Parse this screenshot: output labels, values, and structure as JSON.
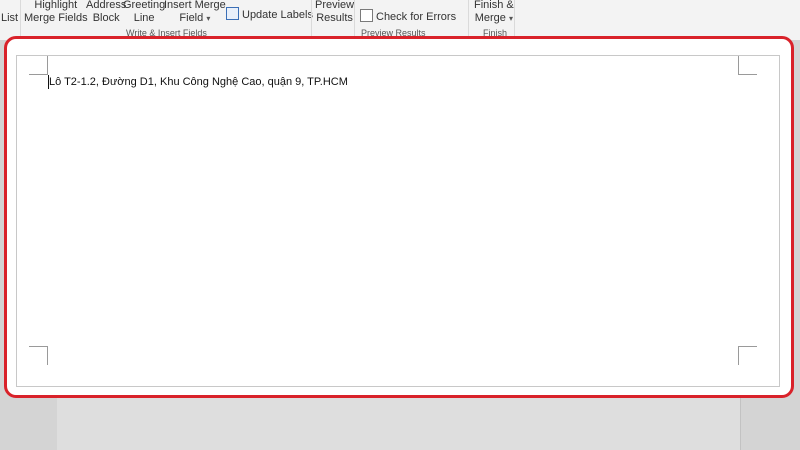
{
  "ribbon": {
    "list_label": "List",
    "highlight_merge_fields": [
      "Highlight",
      "Merge Fields"
    ],
    "address_block": [
      "Address",
      "Block"
    ],
    "greeting_line": [
      "Greeting",
      "Line"
    ],
    "insert_merge_field": [
      "Insert Merge",
      "Field"
    ],
    "update_labels": "Update Labels",
    "group_write_insert": "Write & Insert Fields",
    "preview_results": [
      "Preview",
      "Results"
    ],
    "check_for_errors": "Check for Errors",
    "group_preview": "Preview Results",
    "finish_merge": [
      "Finish &",
      "Merge"
    ],
    "group_finish": "Finish"
  },
  "document": {
    "address_line": "Lô T2-1.2, Đường D1, Khu Công Nghệ Cao, quận 9, TP.HCM"
  },
  "colors": {
    "highlight_border": "#d9222a"
  }
}
